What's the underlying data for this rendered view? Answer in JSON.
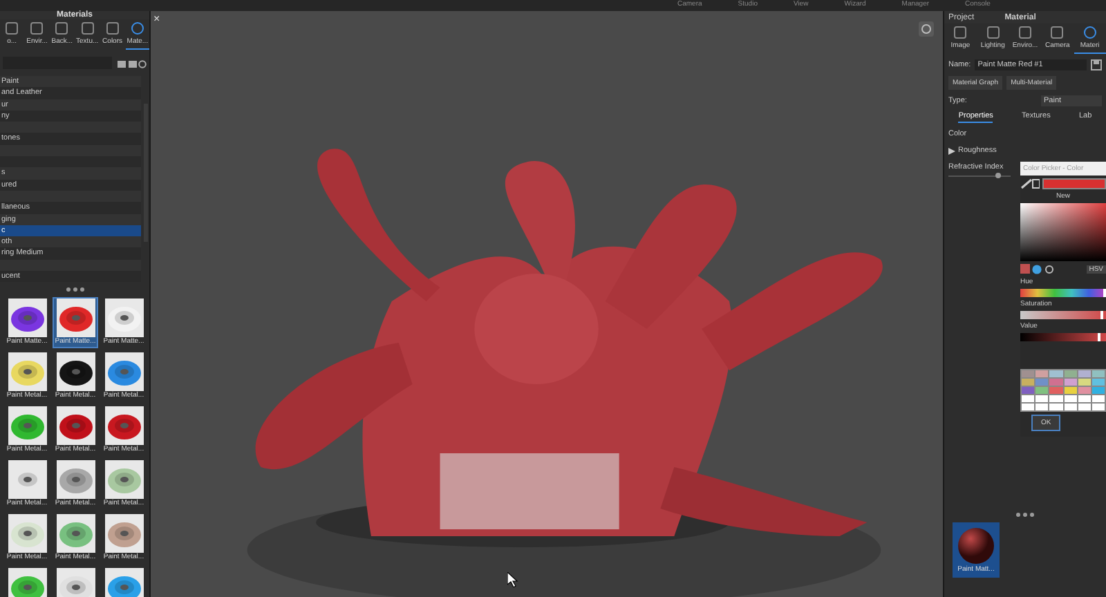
{
  "top_menu": [
    {
      "label": "Camera"
    },
    {
      "label": "Studio"
    },
    {
      "label": "View"
    },
    {
      "label": "Wizard"
    },
    {
      "label": "Manager"
    },
    {
      "label": "Console"
    }
  ],
  "viewport": {
    "close": "×"
  },
  "materials_panel": {
    "title": "Materials",
    "tabs": [
      {
        "label": "o...",
        "selected": false
      },
      {
        "label": "Envir...",
        "selected": false
      },
      {
        "label": "Back...",
        "selected": false
      },
      {
        "label": "Textu...",
        "selected": false
      },
      {
        "label": "Colors",
        "selected": false
      },
      {
        "label": "Mate...",
        "selected": true
      }
    ],
    "categories": [
      {
        "label": "Paint",
        "selected": false
      },
      {
        "label": "and Leather",
        "selected": false
      },
      {
        "label": "ur",
        "selected": false
      },
      {
        "label": "ny",
        "selected": false
      },
      {
        "selected": false
      },
      {
        "label": "tones",
        "selected": false
      },
      {
        "selected": false
      },
      {
        "selected": false
      },
      {
        "label": "s",
        "selected": false
      },
      {
        "label": "ured",
        "selected": false
      },
      {
        "selected": false
      },
      {
        "label": "llaneous",
        "selected": false
      },
      {
        "label": "ging",
        "selected": false
      },
      {
        "label": "c",
        "selected": true
      },
      {
        "label": "oth",
        "selected": false
      },
      {
        "label": "ring Medium",
        "selected": false
      },
      {
        "selected": false
      },
      {
        "label": "ucent",
        "selected": false
      }
    ],
    "thumbnails": [
      {
        "label": "Paint Matte...",
        "color": "#7a35e0",
        "selected": false
      },
      {
        "label": "Paint Matte...",
        "color": "#e02828",
        "selected": true
      },
      {
        "label": "Paint Matte...",
        "color": "#f2f2f2",
        "selected": false
      },
      {
        "label": "Paint Metal...",
        "color": "#e8d860",
        "selected": false
      },
      {
        "label": "Paint Metal...",
        "color": "#151515",
        "selected": false
      },
      {
        "label": "Paint Metal...",
        "color": "#2a8ae0",
        "selected": false
      },
      {
        "label": "Paint Metal...",
        "color": "#30b830",
        "selected": false
      },
      {
        "label": "Paint Metal...",
        "color": "#c0101a",
        "selected": false
      },
      {
        "label": "Paint Metal...",
        "color": "#c81820",
        "selected": false
      },
      {
        "label": "Paint Metal...",
        "color": "#e8e8e8",
        "selected": false
      },
      {
        "label": "Paint Metal...",
        "color": "#a8a8a8",
        "selected": false
      },
      {
        "label": "Paint Metal...",
        "color": "#a8c8a0",
        "selected": false
      },
      {
        "label": "Paint Metal...",
        "color": "#d8e4d0",
        "selected": false
      },
      {
        "label": "Paint Metal...",
        "color": "#78c080",
        "selected": false
      },
      {
        "label": "Paint Metal...",
        "color": "#c0a090",
        "selected": false
      },
      {
        "color": "#40c040",
        "selected": false
      },
      {
        "color": "#e0e0e0",
        "selected": false
      },
      {
        "color": "#2aa0e8",
        "selected": false
      }
    ]
  },
  "material_panel": {
    "header": [
      {
        "label": "Project"
      },
      {
        "label": "Material"
      }
    ],
    "tabs": [
      {
        "label": "Image",
        "selected": false
      },
      {
        "label": "Lighting",
        "selected": false
      },
      {
        "label": "Enviro...",
        "selected": false
      },
      {
        "label": "Camera",
        "selected": false
      },
      {
        "label": "Materi",
        "selected": true
      }
    ],
    "name_label": "Name:",
    "name": "Paint Matte Red #1",
    "buttons": [
      {
        "label": "Material Graph"
      },
      {
        "label": "Multi-Material"
      }
    ],
    "type_label": "Type:",
    "type": "Paint",
    "sub_tabs": [
      {
        "label": "Properties",
        "selected": true
      },
      {
        "label": "Textures",
        "selected": false
      },
      {
        "label": "Lab",
        "selected": false
      }
    ],
    "properties": [
      {
        "label": "Color",
        "kind": "color"
      },
      {
        "label": "Roughness",
        "kind": "group",
        "expanded": false
      },
      {
        "label": "Refractive Index",
        "kind": "slider",
        "level": 0.8
      }
    ],
    "project_thumbnail": {
      "label": "Paint Matt...",
      "selected": true
    }
  },
  "color_picker": {
    "title": "Color Picker - Color",
    "new_label": "New",
    "mode": "HSV",
    "sliders": [
      {
        "label": "Hue",
        "kind": "hue",
        "level": 1.0
      },
      {
        "label": "Saturation",
        "kind": "saturation",
        "level": 0.97
      },
      {
        "label": "Value",
        "kind": "value",
        "level": 0.93
      }
    ],
    "ok": "OK"
  }
}
